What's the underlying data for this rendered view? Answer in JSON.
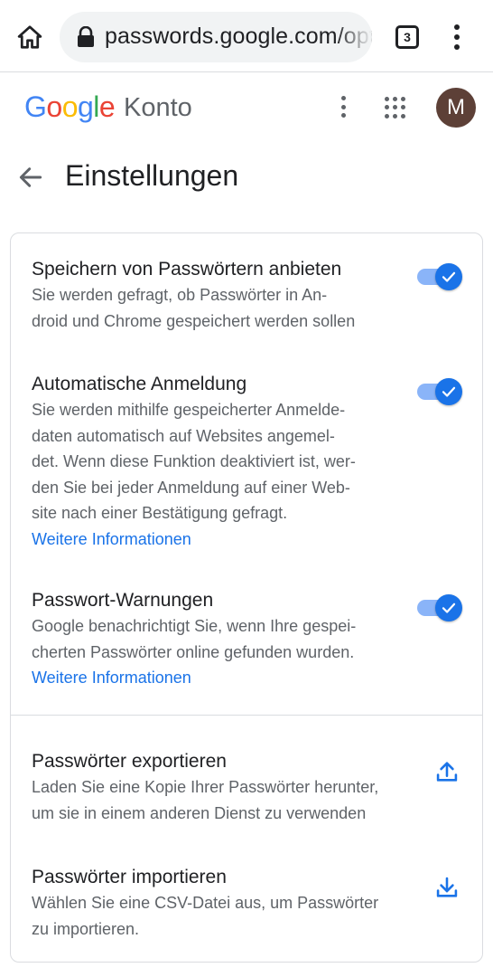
{
  "browser": {
    "url": "passwords.google.com/optio",
    "tab_count": "3",
    "icons": [
      "home-icon",
      "lock-icon",
      "tabs-icon",
      "more-vert-icon"
    ]
  },
  "header": {
    "logo": "Google",
    "account_label": "Konto",
    "avatar_letter": "M",
    "avatar_color": "#5d4037"
  },
  "page": {
    "title": "Einstellungen"
  },
  "settings": [
    {
      "title": "Speichern von Passwörtern anbieten",
      "desc_lines": [
        "Sie werden gefragt, ob Passwörter in An-",
        "droid und Chrome gespeichert werden sollen"
      ],
      "enabled": true
    },
    {
      "title": "Automatische Anmeldung",
      "desc_lines": [
        "Sie werden mithilfe gespeicherter Anmelde-",
        "daten automatisch auf Websites angemel-",
        "det. Wenn diese Funktion deaktiviert ist, wer-",
        "den Sie bei jeder Anmeldung auf einer Web-",
        "site nach einer Bestätigung gefragt."
      ],
      "link": "Weitere Informationen",
      "enabled": true
    },
    {
      "title": "Passwort-Warnungen",
      "desc_lines": [
        "Google benachrichtigt Sie, wenn Ihre gespei-",
        "cherten Passwörter online gefunden wurden."
      ],
      "link": "Weitere Informationen",
      "enabled": true
    }
  ],
  "actions": [
    {
      "title": "Passwörter exportieren",
      "desc_lines": [
        "Laden Sie eine Kopie Ihrer Passwörter herunter,",
        "um sie in einem anderen Dienst zu verwenden"
      ],
      "icon": "upload-icon"
    },
    {
      "title": "Passwörter importieren",
      "desc_lines": [
        "Wählen Sie eine CSV-Datei aus, um Passwörter",
        "zu importieren."
      ],
      "icon": "download-icon"
    }
  ],
  "colors": {
    "accent": "#1a73e8",
    "toggle_track": "#8ab4f8",
    "text_primary": "#202124",
    "text_secondary": "#5f6368"
  }
}
